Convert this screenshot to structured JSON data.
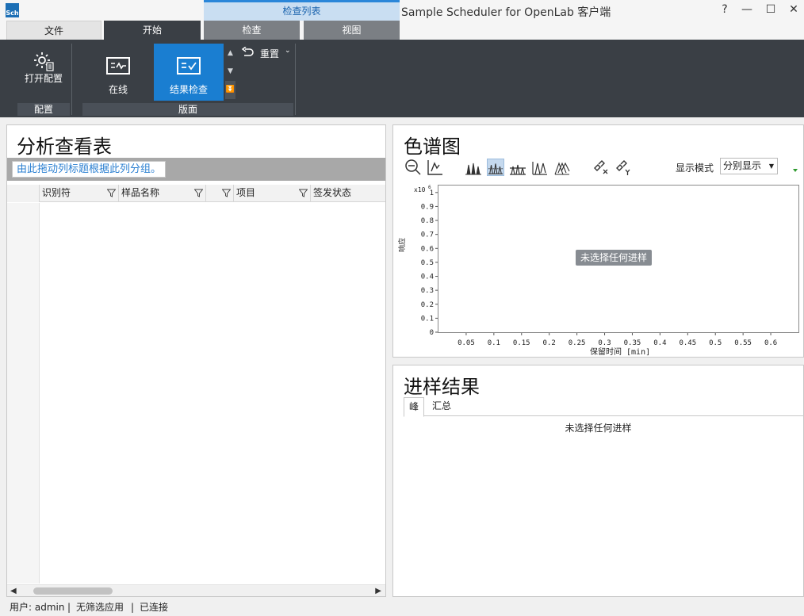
{
  "window": {
    "title": "Sample Scheduler for OpenLab 客户端",
    "context_group": "检查列表",
    "logo_text": "Sch",
    "controls": {
      "help": "?",
      "minimize": "—",
      "maximize": "☐",
      "close": "✕"
    }
  },
  "ribbon_tabs": [
    "文件",
    "开始",
    "检查",
    "视图"
  ],
  "ribbon": {
    "open_config": "打开配置",
    "group_config": "配置",
    "online": "在线",
    "result_check": "结果检查",
    "group_layout": "版面",
    "reset": "重置"
  },
  "left_panel": {
    "title": "分析查看表",
    "group_hint": "由此拖动列标题根据此列分组。",
    "columns": [
      "识别符",
      "样品名称",
      "项目",
      "签发状态"
    ]
  },
  "chrom_panel": {
    "title": "色谱图",
    "display_mode_label": "显示模式",
    "display_mode_value": "分别显示",
    "no_selection": "未选择任何进样"
  },
  "chart_data": {
    "type": "line",
    "series": [],
    "xlabel": "保留时间 [min]",
    "ylabel": "响应",
    "y_multiplier": "x10",
    "y_multiplier_exp": "6",
    "x_ticks": [
      "0.05",
      "0.1",
      "0.15",
      "0.2",
      "0.25",
      "0.3",
      "0.35",
      "0.4",
      "0.45",
      "0.5",
      "0.55",
      "0.6"
    ],
    "y_ticks": [
      "0",
      "0.1",
      "0.2",
      "0.3",
      "0.4",
      "0.5",
      "0.6",
      "0.7",
      "0.8",
      "0.9",
      "1"
    ],
    "xlim": [
      0.0,
      0.65
    ],
    "ylim": [
      0,
      1.05
    ],
    "grid": true
  },
  "results_panel": {
    "title": "进样结果",
    "tabs": [
      "峰",
      "汇总"
    ],
    "empty": "未选择任何进样"
  },
  "status": {
    "user": "用户: admin",
    "sep": "|",
    "filter": "无筛选应用",
    "connection": "已连接"
  },
  "colors": {
    "ribbon_bg": "#3a3f45",
    "accent": "#1a7ed1",
    "link": "#2a7fd1"
  }
}
